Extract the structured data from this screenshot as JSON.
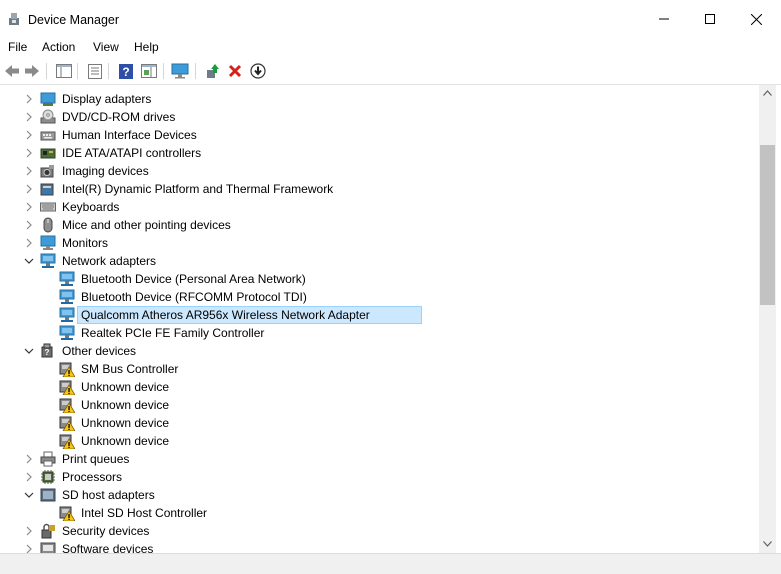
{
  "window": {
    "title": "Device Manager"
  },
  "menu": [
    "File",
    "Action",
    "View",
    "Help"
  ],
  "tree": [
    {
      "label": "Display adapters",
      "level": 0,
      "expanded": false,
      "icon": "display-adapter-icon"
    },
    {
      "label": "DVD/CD-ROM drives",
      "level": 0,
      "expanded": false,
      "icon": "dvd-drive-icon"
    },
    {
      "label": "Human Interface Devices",
      "level": 0,
      "expanded": false,
      "icon": "hid-icon"
    },
    {
      "label": "IDE ATA/ATAPI controllers",
      "level": 0,
      "expanded": false,
      "icon": "ide-controller-icon"
    },
    {
      "label": "Imaging devices",
      "level": 0,
      "expanded": false,
      "icon": "camera-icon"
    },
    {
      "label": "Intel(R) Dynamic Platform and Thermal Framework",
      "level": 0,
      "expanded": false,
      "icon": "system-device-icon"
    },
    {
      "label": "Keyboards",
      "level": 0,
      "expanded": false,
      "icon": "keyboard-icon"
    },
    {
      "label": "Mice and other pointing devices",
      "level": 0,
      "expanded": false,
      "icon": "mouse-icon"
    },
    {
      "label": "Monitors",
      "level": 0,
      "expanded": false,
      "icon": "monitor-icon"
    },
    {
      "label": "Network adapters",
      "level": 0,
      "expanded": true,
      "icon": "network-adapter-icon"
    },
    {
      "label": "Bluetooth Device (Personal Area Network)",
      "level": 1,
      "icon": "network-adapter-icon"
    },
    {
      "label": "Bluetooth Device (RFCOMM Protocol TDI)",
      "level": 1,
      "icon": "network-adapter-icon"
    },
    {
      "label": "Qualcomm Atheros AR956x Wireless Network Adapter",
      "level": 1,
      "icon": "network-adapter-icon",
      "selected": true
    },
    {
      "label": "Realtek PCIe FE Family Controller",
      "level": 1,
      "icon": "network-adapter-icon"
    },
    {
      "label": "Other devices",
      "level": 0,
      "expanded": true,
      "icon": "unknown-device-icon"
    },
    {
      "label": "SM Bus Controller",
      "level": 1,
      "icon": "warning-device-icon"
    },
    {
      "label": "Unknown device",
      "level": 1,
      "icon": "warning-device-icon"
    },
    {
      "label": "Unknown device",
      "level": 1,
      "icon": "warning-device-icon"
    },
    {
      "label": "Unknown device",
      "level": 1,
      "icon": "warning-device-icon"
    },
    {
      "label": "Unknown device",
      "level": 1,
      "icon": "warning-device-icon"
    },
    {
      "label": "Print queues",
      "level": 0,
      "expanded": false,
      "icon": "printer-icon"
    },
    {
      "label": "Processors",
      "level": 0,
      "expanded": false,
      "icon": "processor-icon"
    },
    {
      "label": "SD host adapters",
      "level": 0,
      "expanded": true,
      "icon": "sd-host-icon"
    },
    {
      "label": "Intel SD Host Controller",
      "level": 1,
      "icon": "warning-device-icon"
    },
    {
      "label": "Security devices",
      "level": 0,
      "expanded": false,
      "icon": "security-device-icon"
    },
    {
      "label": "Software devices",
      "level": 0,
      "expanded": false,
      "icon": "software-device-icon"
    }
  ],
  "colors": {
    "selection": "#cce8ff",
    "selection_border": "#99d1ff",
    "network_blue": "#2e8fd6"
  }
}
